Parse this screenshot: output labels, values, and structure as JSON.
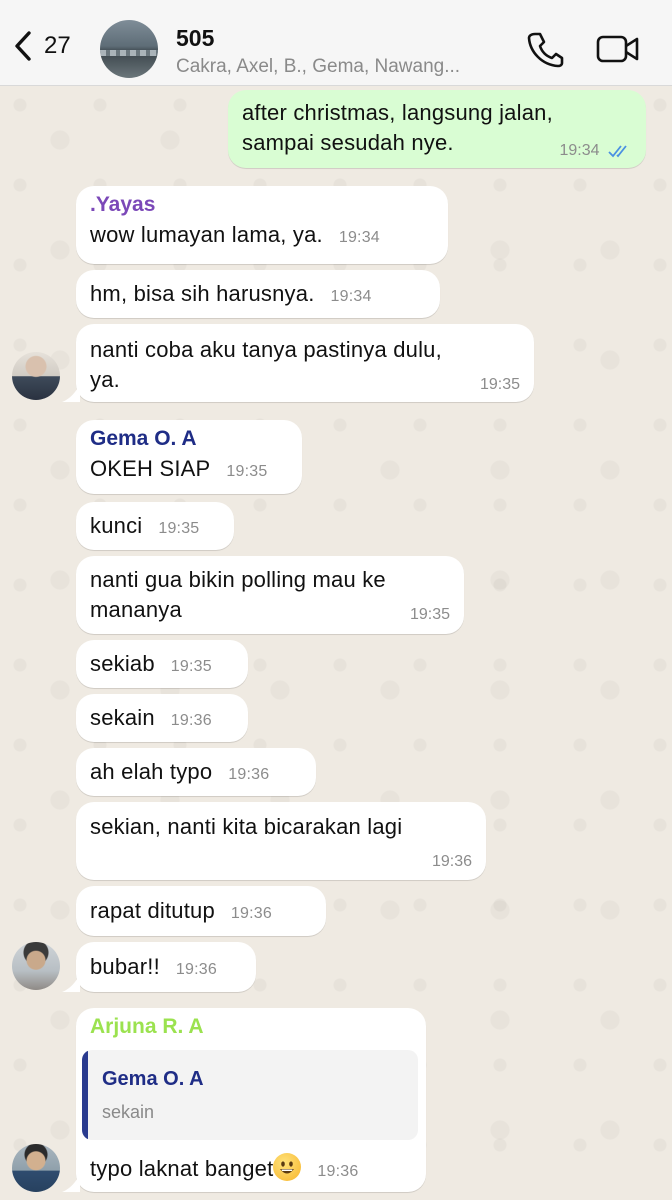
{
  "header": {
    "back_count": "27",
    "title": "505",
    "subtitle": "Cakra, Axel, B., Gema, Nawang..."
  },
  "messages": [
    {
      "text_l1": "after christmas, langsung jalan,",
      "text_l2": "sampai sesudah nye.",
      "time": "19:34",
      "status": "read"
    },
    {
      "sender": ".Yayas",
      "text": "wow lumayan lama, ya.",
      "time": "19:34"
    },
    {
      "text": "hm, bisa sih harusnya.",
      "time": "19:34"
    },
    {
      "text_l1": "nanti coba aku tanya pastinya dulu,",
      "text_l2": "ya.",
      "time": "19:35"
    },
    {
      "sender": "Gema O. A",
      "text": "OKEH SIAP",
      "time": "19:35"
    },
    {
      "text": "kunci",
      "time": "19:35"
    },
    {
      "text_l1": "nanti gua bikin polling mau ke",
      "text_l2": "mananya",
      "time": "19:35"
    },
    {
      "text": "sekiab",
      "time": "19:35"
    },
    {
      "text": "sekain",
      "time": "19:36"
    },
    {
      "text": "ah elah typo",
      "time": "19:36"
    },
    {
      "text": "sekian, nanti kita bicarakan lagi",
      "time": "19:36"
    },
    {
      "text": "rapat ditutup",
      "time": "19:36"
    },
    {
      "text": "bubar!!",
      "time": "19:36"
    },
    {
      "sender": "Arjuna R. A",
      "quote_sender": "Gema O. A",
      "quote_text": "sekain",
      "text": "typo laknat banget",
      "time": "19:36",
      "emoji": "grinning-face-emoji"
    }
  ],
  "colors": {
    "sender_yayas": "#7b48b8",
    "sender_gema": "#1f2d86",
    "sender_arjuna": "#9be24f",
    "outgoing_bubble": "#d9fdd3",
    "read_ticks": "#4a90e2"
  },
  "icons": [
    "chevron-left-icon",
    "phone-icon",
    "video-camera-icon",
    "double-check-icon"
  ]
}
